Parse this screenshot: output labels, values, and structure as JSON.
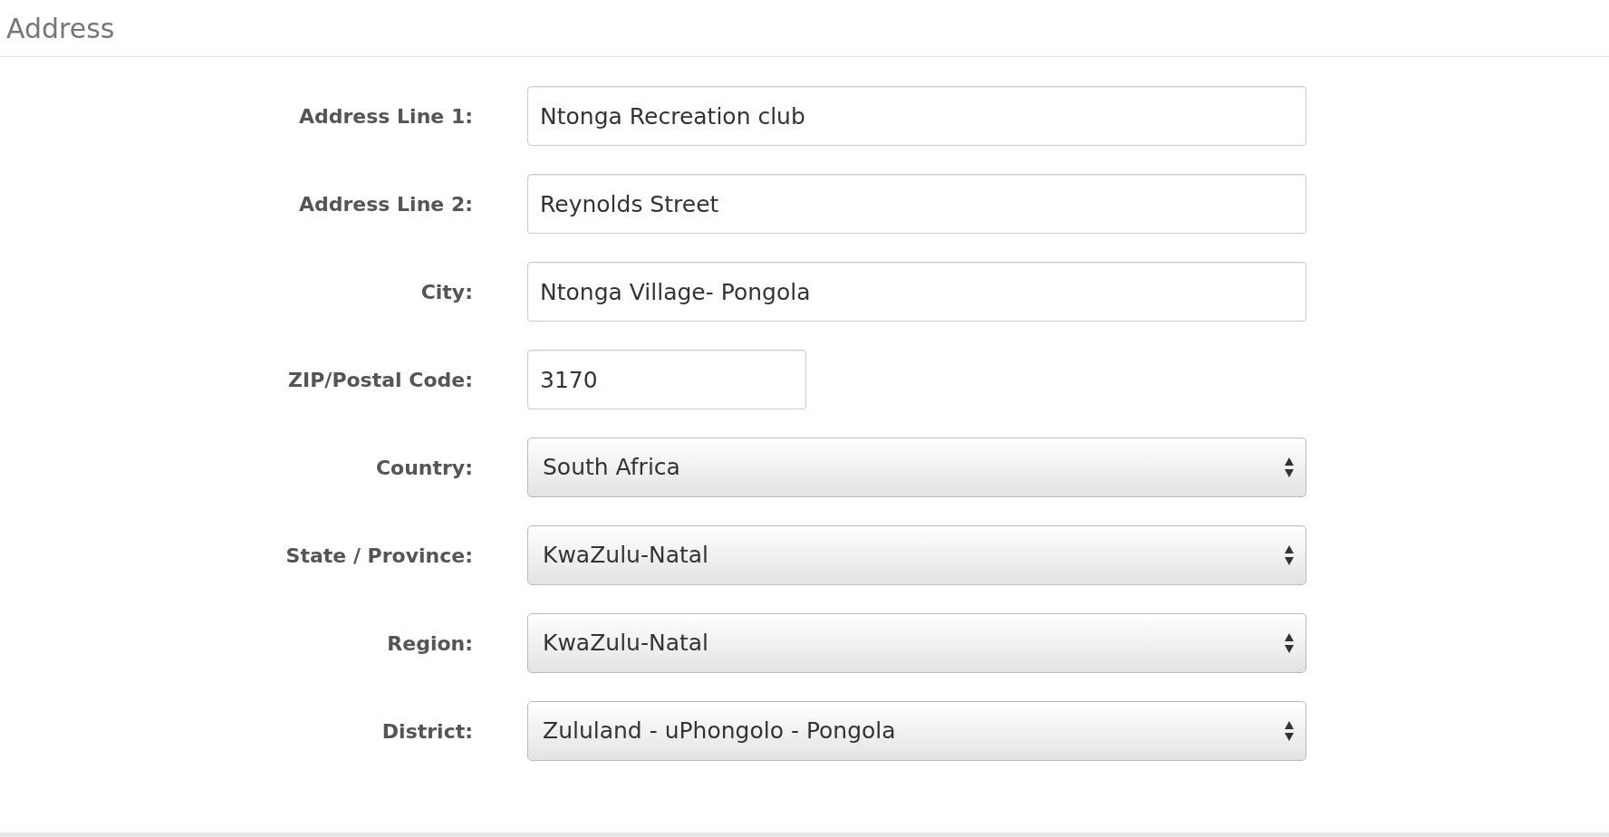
{
  "section": {
    "title": "Address"
  },
  "fields": [
    {
      "label": "Address Line 1:",
      "kind": "text",
      "value": "Ntonga Recreation club"
    },
    {
      "label": "Address Line 2:",
      "kind": "text",
      "value": "Reynolds Street"
    },
    {
      "label": "City:",
      "kind": "text",
      "value": "Ntonga Village- Pongola"
    },
    {
      "label": "ZIP/Postal Code:",
      "kind": "code",
      "value": "3170"
    },
    {
      "label": "Country:",
      "kind": "select",
      "value": "South Africa"
    },
    {
      "label": "State / Province:",
      "kind": "select",
      "value": "KwaZulu-Natal"
    },
    {
      "label": "Region:",
      "kind": "select",
      "value": "KwaZulu-Natal"
    },
    {
      "label": "District:",
      "kind": "select",
      "value": "Zululand - uPhongolo - Pongola"
    }
  ]
}
